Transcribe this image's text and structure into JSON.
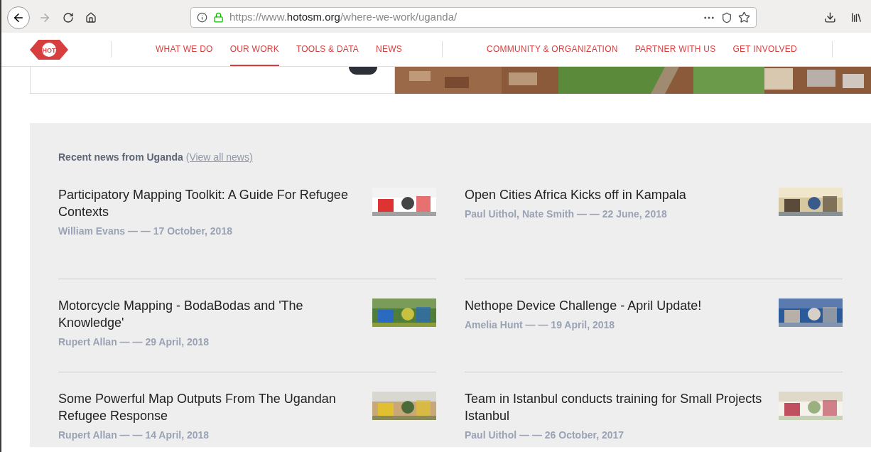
{
  "browser": {
    "url_prefix": "https://www.",
    "url_host": "hotosm.org",
    "url_path": "/where-we-work/uganda/"
  },
  "logo": {
    "text": "HOT"
  },
  "nav_left": [
    {
      "label": "WHAT WE DO",
      "selected": false
    },
    {
      "label": "OUR WORK",
      "selected": true
    },
    {
      "label": "TOOLS & DATA",
      "selected": false
    },
    {
      "label": "NEWS",
      "selected": false
    }
  ],
  "nav_right": [
    {
      "label": "COMMUNITY & ORGANIZATION",
      "selected": false
    },
    {
      "label": "PARTNER WITH US",
      "selected": false
    },
    {
      "label": "GET INVOLVED",
      "selected": false
    }
  ],
  "news": {
    "heading": "Recent news from Uganda",
    "link": "(View all news)",
    "articles": [
      {
        "title": "Participatory Mapping Toolkit: A Guide For Refugee Contexts",
        "byline": "William Evans — — 17 October, 2018"
      },
      {
        "title": "Open Cities Africa Kicks off in Kampala",
        "byline": "Paul Uithol, Nate Smith — — 22 June, 2018"
      },
      {
        "title": "Motorcycle Mapping - BodaBodas and 'The Knowledge'",
        "byline": "Rupert Allan — — 29 April, 2018"
      },
      {
        "title": "Nethope Device Challenge - April Update!",
        "byline": "Amelia Hunt — — 19 April, 2018"
      },
      {
        "title": "Some Powerful Map Outputs From The Ugandan Refugee Response",
        "byline": "Rupert Allan — — 14 April, 2018"
      },
      {
        "title": "Team in Istanbul conducts training for Small Projects Istanbul",
        "byline": "Paul Uithol — — 26 October, 2017"
      }
    ]
  }
}
